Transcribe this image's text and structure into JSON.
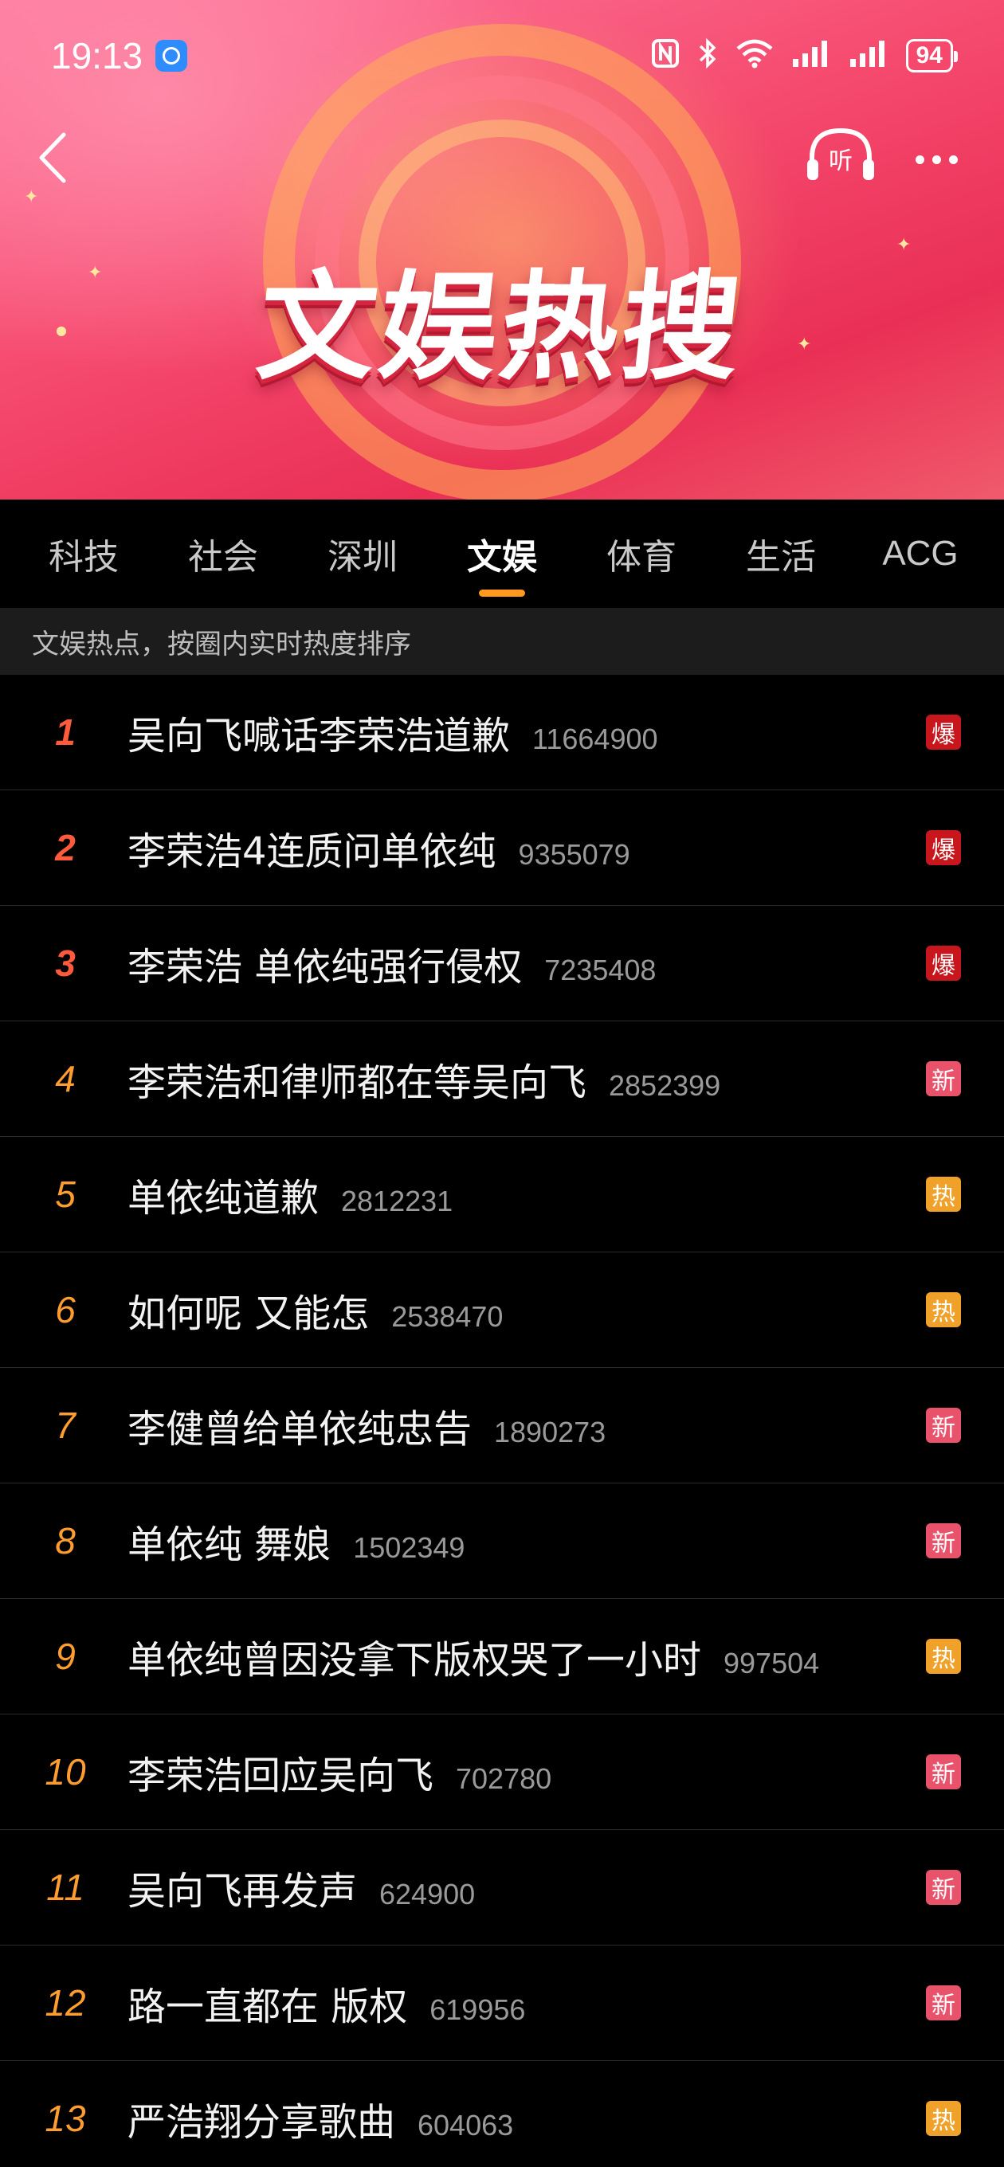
{
  "status_bar": {
    "time": "19:13",
    "battery": "94"
  },
  "header": {
    "title": "文娱热搜",
    "listen_label": "听"
  },
  "tabs": [
    {
      "label": "科技",
      "active": false
    },
    {
      "label": "社会",
      "active": false
    },
    {
      "label": "深圳",
      "active": false
    },
    {
      "label": "文娱",
      "active": true
    },
    {
      "label": "体育",
      "active": false
    },
    {
      "label": "生活",
      "active": false
    },
    {
      "label": "ACG",
      "active": false
    }
  ],
  "subtitle": "文娱热点，按圈内实时热度排序",
  "tag_colors": {
    "爆": "#c8161d",
    "新": "#e8536b",
    "热": "#f0a12a"
  },
  "items": [
    {
      "rank": "1",
      "title": "吴向飞喊话李荣浩道歉",
      "count": "11664900",
      "tag": "爆"
    },
    {
      "rank": "2",
      "title": "李荣浩4连质问单依纯",
      "count": "9355079",
      "tag": "爆"
    },
    {
      "rank": "3",
      "title": "李荣浩 单依纯强行侵权",
      "count": "7235408",
      "tag": "爆"
    },
    {
      "rank": "4",
      "title": "李荣浩和律师都在等吴向飞",
      "count": "2852399",
      "tag": "新"
    },
    {
      "rank": "5",
      "title": "单依纯道歉",
      "count": "2812231",
      "tag": "热"
    },
    {
      "rank": "6",
      "title": "如何呢 又能怎",
      "count": "2538470",
      "tag": "热"
    },
    {
      "rank": "7",
      "title": "李健曾给单依纯忠告",
      "count": "1890273",
      "tag": "新"
    },
    {
      "rank": "8",
      "title": "单依纯 舞娘",
      "count": "1502349",
      "tag": "新"
    },
    {
      "rank": "9",
      "title": "单依纯曾因没拿下版权哭了一小时",
      "count": "997504",
      "tag": "热"
    },
    {
      "rank": "10",
      "title": "李荣浩回应吴向飞",
      "count": "702780",
      "tag": "新"
    },
    {
      "rank": "11",
      "title": "吴向飞再发声",
      "count": "624900",
      "tag": "新"
    },
    {
      "rank": "12",
      "title": "路一直都在 版权",
      "count": "619956",
      "tag": "新"
    },
    {
      "rank": "13",
      "title": "严浩翔分享歌曲",
      "count": "604063",
      "tag": "热"
    }
  ]
}
